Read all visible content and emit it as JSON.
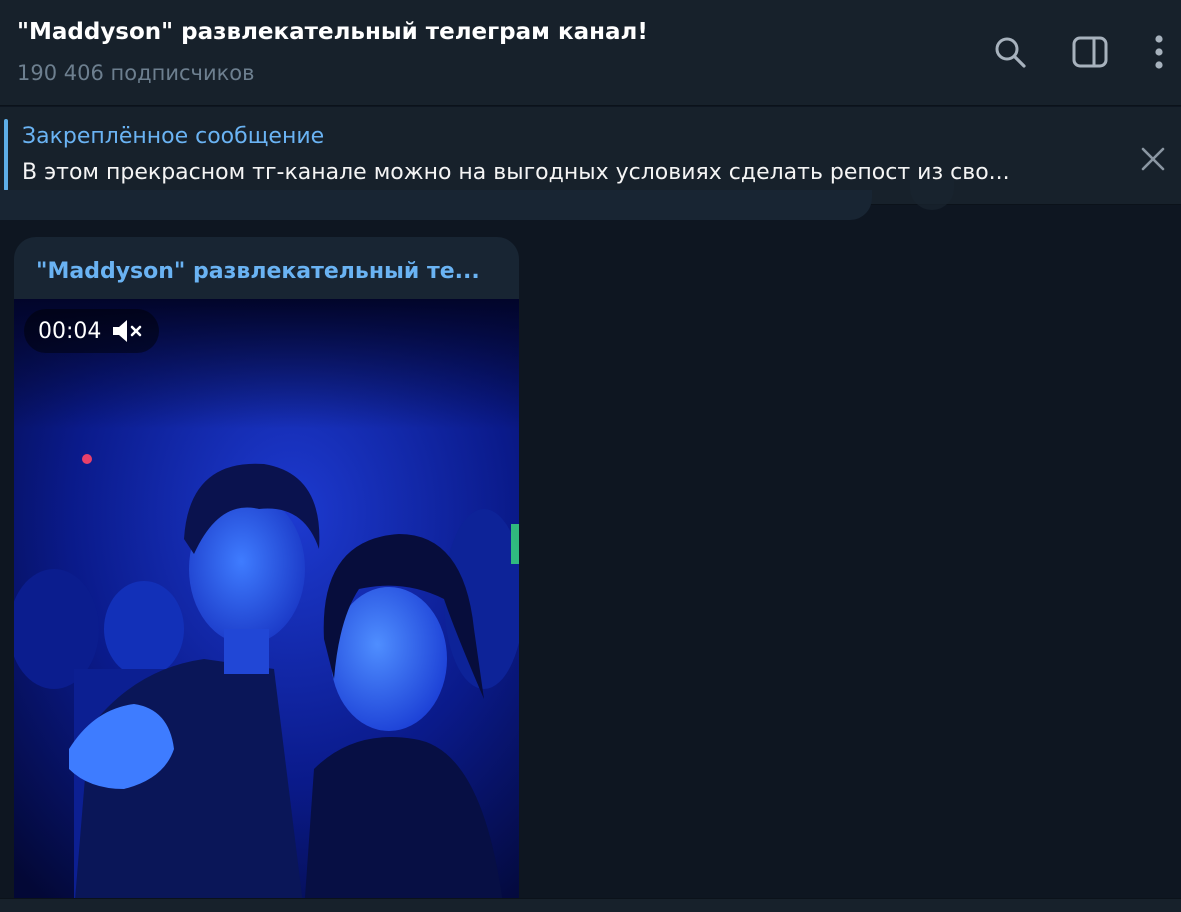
{
  "header": {
    "title": "\"Maddyson\" развлекательный телеграм канал!",
    "subtitle": "190 406 подписчиков",
    "icons": [
      "search-icon",
      "sidebar-toggle-icon",
      "more-vert-icon"
    ]
  },
  "pinned": {
    "title": "Закреплённое сообщение",
    "text": "В этом прекрасном тг-канале можно на выгодных условиях сделать репост из сво...",
    "close_icon": "close-icon"
  },
  "message": {
    "author": "\"Maddyson\" развлекательный те...",
    "video": {
      "duration": "00:04",
      "muted_icon": "volume-muted-icon"
    }
  },
  "colors": {
    "background": "#0e1621",
    "header": "#17212b",
    "bubble": "#182533",
    "accent": "#6ab3f3",
    "muted_text": "#6d7f8f"
  }
}
